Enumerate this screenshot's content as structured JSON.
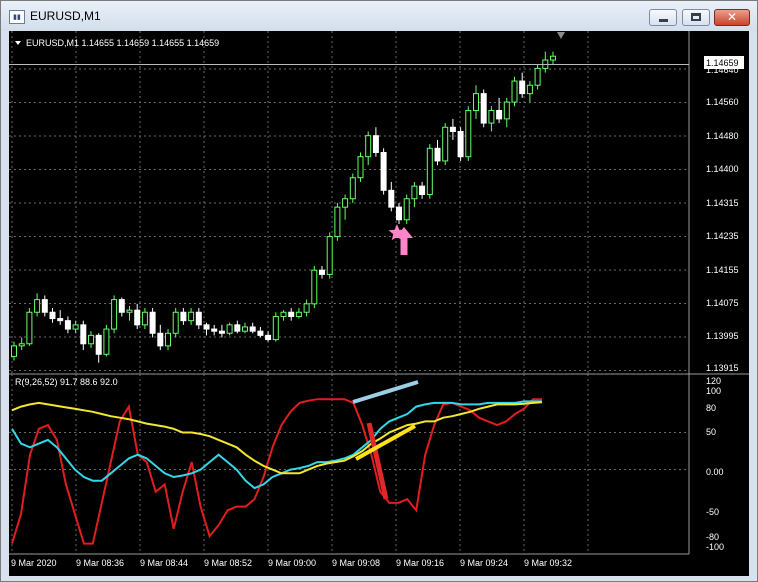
{
  "window": {
    "title": "EURUSD,M1",
    "close_glyph": "✕"
  },
  "icons": {
    "app": "chart-window-icon",
    "minimize": "minimize-icon",
    "maximize": "maximize-icon",
    "close": "close-icon",
    "dropdown": "dropdown-triangle-icon",
    "star": "star-icon",
    "arrow": "up-arrow-icon",
    "scroll_marker": "chart-shift-marker-icon"
  },
  "main_panel": {
    "info": "EURUSD,M1  1.14655 1.14659 1.14655 1.14659",
    "current_price": "1.14659",
    "price_labels": [
      "1.14640",
      "1.14560",
      "1.14480",
      "1.14400",
      "1.14315",
      "1.14235",
      "1.14155",
      "1.14075",
      "1.13995",
      "1.13915"
    ]
  },
  "sub_panel": {
    "info": "R(9,26,52) 91.7 88.6 92.0",
    "scale_labels": [
      "120",
      "100",
      "80",
      "50",
      "0.00",
      "-50",
      "-80",
      "-100"
    ]
  },
  "time_labels": [
    "9 Mar 2020",
    "9 Mar 08:36",
    "9 Mar 08:44",
    "9 Mar 08:52",
    "9 Mar 09:00",
    "9 Mar 09:08",
    "9 Mar 09:16",
    "9 Mar 09:24",
    "9 Mar 09:32"
  ],
  "colors": {
    "background": "#000000",
    "grid": "#6a6a6a",
    "bull_candle": "#66ff66",
    "bear_candle": "#ffffff",
    "line_red": "#e01e1e",
    "line_cyan": "#33d8e8",
    "line_yellow": "#f2e62e",
    "annotation_pink": "#ff84c8",
    "annotation_lightblue": "#9ccfe6",
    "annotation_red": "#e0282a",
    "annotation_yellow": "#ffe31a",
    "scale_text": "#ffffff"
  },
  "chart_data": {
    "type": "candlestick",
    "title": "EURUSD,M1",
    "price_ylim": [
      1.13915,
      1.147
    ],
    "candles": [
      [
        1.13945,
        1.1398,
        1.13935,
        1.1397
      ],
      [
        1.1397,
        1.1399,
        1.1396,
        1.13975
      ],
      [
        1.13975,
        1.1406,
        1.1397,
        1.1405
      ],
      [
        1.1405,
        1.14095,
        1.1404,
        1.1408
      ],
      [
        1.1408,
        1.1409,
        1.1404,
        1.1405
      ],
      [
        1.1405,
        1.1406,
        1.14025,
        1.14035
      ],
      [
        1.14035,
        1.14055,
        1.1402,
        1.1403
      ],
      [
        1.1403,
        1.1404,
        1.14,
        1.1401
      ],
      [
        1.1401,
        1.1403,
        1.14,
        1.1402
      ],
      [
        1.1402,
        1.1403,
        1.1396,
        1.13975
      ],
      [
        1.13975,
        1.14005,
        1.13965,
        1.13995
      ],
      [
        1.13995,
        1.14,
        1.1393,
        1.1395
      ],
      [
        1.1395,
        1.1402,
        1.13945,
        1.1401
      ],
      [
        1.1401,
        1.1409,
        1.14,
        1.1408
      ],
      [
        1.1408,
        1.14085,
        1.1404,
        1.1405
      ],
      [
        1.1405,
        1.14065,
        1.1403,
        1.14055
      ],
      [
        1.14055,
        1.1407,
        1.1401,
        1.1402
      ],
      [
        1.1402,
        1.1406,
        1.1401,
        1.1405
      ],
      [
        1.1405,
        1.1406,
        1.1399,
        1.14
      ],
      [
        1.14,
        1.1402,
        1.1396,
        1.1397
      ],
      [
        1.1397,
        1.1401,
        1.1396,
        1.14
      ],
      [
        1.14,
        1.1406,
        1.1399,
        1.1405
      ],
      [
        1.1405,
        1.1406,
        1.1402,
        1.1403
      ],
      [
        1.1403,
        1.1406,
        1.1402,
        1.1405
      ],
      [
        1.1405,
        1.1406,
        1.1401,
        1.1402
      ],
      [
        1.1402,
        1.14025,
        1.13995,
        1.1401
      ],
      [
        1.1401,
        1.1402,
        1.13995,
        1.14005
      ],
      [
        1.14005,
        1.1402,
        1.1399,
        1.14
      ],
      [
        1.14,
        1.14025,
        1.13995,
        1.1402
      ],
      [
        1.1402,
        1.1403,
        1.14,
        1.14005
      ],
      [
        1.14005,
        1.14025,
        1.14,
        1.14015
      ],
      [
        1.14015,
        1.14025,
        1.14,
        1.14005
      ],
      [
        1.14005,
        1.14015,
        1.1399,
        1.13995
      ],
      [
        1.13995,
        1.14005,
        1.1398,
        1.13985
      ],
      [
        1.13985,
        1.1405,
        1.1398,
        1.1404
      ],
      [
        1.1404,
        1.14055,
        1.1403,
        1.1405
      ],
      [
        1.1405,
        1.1406,
        1.1403,
        1.1404
      ],
      [
        1.1404,
        1.1406,
        1.14035,
        1.1405
      ],
      [
        1.1405,
        1.1408,
        1.1404,
        1.1407
      ],
      [
        1.1407,
        1.1416,
        1.1406,
        1.1415
      ],
      [
        1.1415,
        1.1416,
        1.1413,
        1.1414
      ],
      [
        1.1414,
        1.1424,
        1.1413,
        1.1423
      ],
      [
        1.1423,
        1.1431,
        1.1422,
        1.143
      ],
      [
        1.143,
        1.1433,
        1.1427,
        1.1432
      ],
      [
        1.1432,
        1.1438,
        1.1431,
        1.1437
      ],
      [
        1.1437,
        1.1443,
        1.1436,
        1.1442
      ],
      [
        1.1442,
        1.1448,
        1.144,
        1.1447
      ],
      [
        1.1447,
        1.1449,
        1.1442,
        1.1443
      ],
      [
        1.1443,
        1.1444,
        1.1433,
        1.1434
      ],
      [
        1.1434,
        1.1436,
        1.1429,
        1.143
      ],
      [
        1.143,
        1.1431,
        1.1426,
        1.1427
      ],
      [
        1.1427,
        1.1433,
        1.1426,
        1.1432
      ],
      [
        1.1432,
        1.1436,
        1.143,
        1.1435
      ],
      [
        1.1435,
        1.1436,
        1.1432,
        1.1433
      ],
      [
        1.1433,
        1.1445,
        1.1432,
        1.1444
      ],
      [
        1.1444,
        1.1446,
        1.144,
        1.1441
      ],
      [
        1.1441,
        1.145,
        1.144,
        1.1449
      ],
      [
        1.1449,
        1.1451,
        1.1446,
        1.1448
      ],
      [
        1.1448,
        1.1449,
        1.1441,
        1.1442
      ],
      [
        1.1442,
        1.1454,
        1.1441,
        1.1453
      ],
      [
        1.1453,
        1.1459,
        1.1451,
        1.1457
      ],
      [
        1.1457,
        1.1458,
        1.1449,
        1.145
      ],
      [
        1.145,
        1.1454,
        1.1448,
        1.1453
      ],
      [
        1.1453,
        1.1456,
        1.145,
        1.1451
      ],
      [
        1.1451,
        1.1456,
        1.1449,
        1.1455
      ],
      [
        1.1455,
        1.1461,
        1.1454,
        1.146
      ],
      [
        1.146,
        1.1462,
        1.1456,
        1.1457
      ],
      [
        1.1457,
        1.146,
        1.1455,
        1.1459
      ],
      [
        1.1459,
        1.1464,
        1.1458,
        1.1463
      ],
      [
        1.1463,
        1.1467,
        1.1462,
        1.1465
      ],
      [
        1.1465,
        1.1467,
        1.1464,
        1.14659
      ]
    ],
    "oscillator_ylim": [
      -110,
      125
    ],
    "series": [
      {
        "color": "#e01e1e",
        "values": [
          -100,
          -60,
          20,
          55,
          60,
          40,
          -20,
          -60,
          -100,
          -100,
          -45,
          10,
          65,
          85,
          20,
          10,
          -30,
          -20,
          -80,
          -30,
          10,
          -50,
          -90,
          -75,
          -55,
          -50,
          -50,
          -40,
          -10,
          30,
          60,
          78,
          90,
          93,
          95,
          95,
          95,
          95,
          90,
          60,
          20,
          -30,
          -45,
          -45,
          -40,
          -55,
          20,
          60,
          88,
          90,
          85,
          80,
          70,
          65,
          60,
          65,
          75,
          82,
          95,
          95
        ]
      },
      {
        "color": "#33d8e8",
        "values": [
          55,
          35,
          30,
          35,
          40,
          30,
          15,
          0,
          -10,
          -15,
          -15,
          -5,
          5,
          15,
          20,
          15,
          5,
          -5,
          -10,
          -8,
          -5,
          0,
          10,
          20,
          10,
          0,
          -15,
          -25,
          -20,
          -10,
          -5,
          0,
          2,
          5,
          10,
          10,
          12,
          15,
          20,
          30,
          40,
          55,
          65,
          70,
          75,
          85,
          88,
          90,
          90,
          90,
          88,
          88,
          88,
          90,
          90,
          90,
          90,
          92,
          92,
          92
        ]
      },
      {
        "color": "#f2e62e",
        "values": [
          80,
          85,
          88,
          90,
          88,
          86,
          84,
          82,
          80,
          78,
          75,
          72,
          70,
          68,
          65,
          62,
          60,
          58,
          55,
          50,
          50,
          48,
          45,
          40,
          35,
          30,
          20,
          12,
          5,
          0,
          -5,
          -5,
          -5,
          0,
          5,
          8,
          10,
          12,
          18,
          25,
          35,
          42,
          50,
          55,
          60,
          62,
          65,
          65,
          70,
          72,
          75,
          78,
          82,
          85,
          88,
          88,
          88,
          89,
          90,
          91
        ]
      }
    ]
  }
}
